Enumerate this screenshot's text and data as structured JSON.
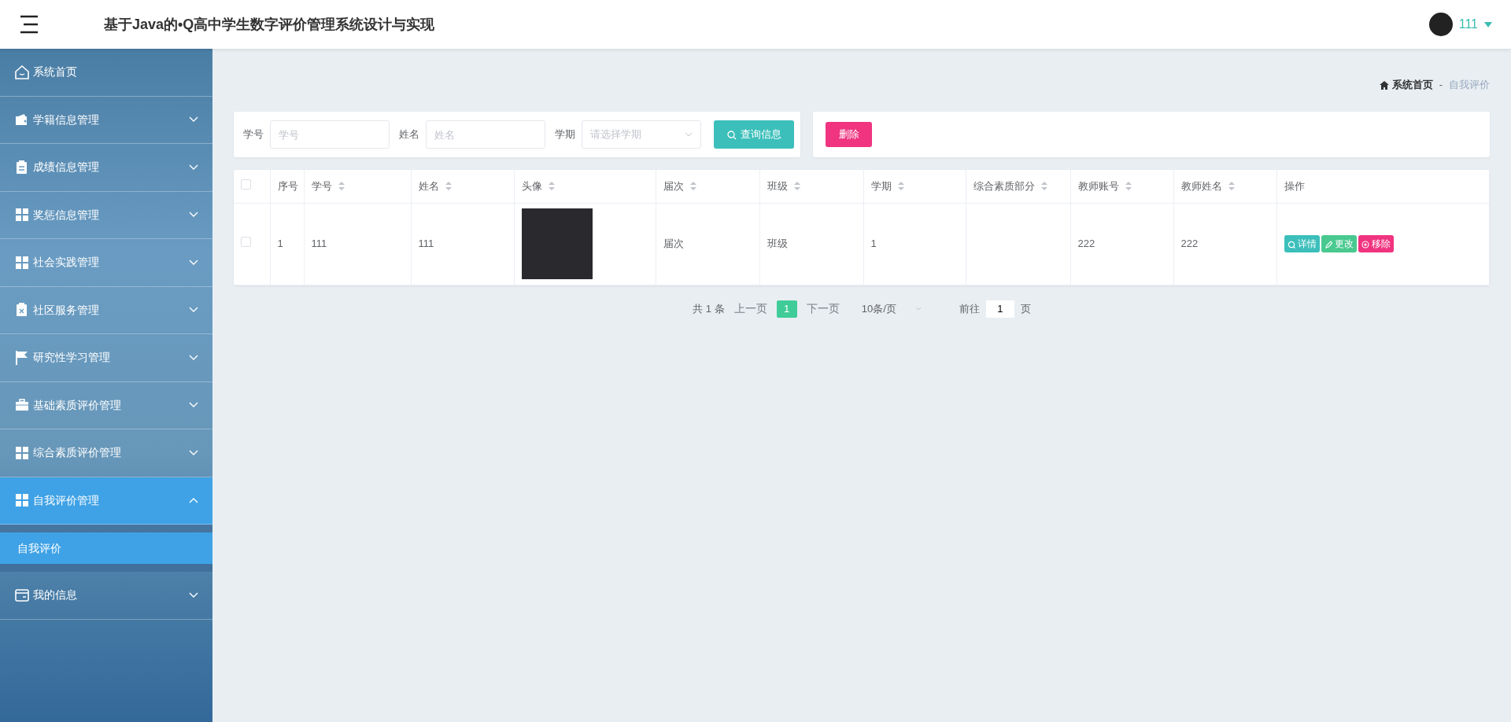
{
  "header": {
    "title": "基于Java的•Q高中学生数字评价管理系统设计与实现",
    "user_name": "111"
  },
  "sidebar": {
    "items": [
      {
        "label": "系统首页",
        "selected": false
      },
      {
        "label": "学籍信息管理",
        "expanded": false,
        "selected": false
      },
      {
        "label": "成绩信息管理",
        "expanded": false,
        "selected": false
      },
      {
        "label": "奖惩信息管理",
        "expanded": false,
        "selected": false
      },
      {
        "label": "社会实践管理",
        "expanded": false,
        "selected": false
      },
      {
        "label": "社区服务管理",
        "expanded": false,
        "selected": false
      },
      {
        "label": "研究性学习管理",
        "expanded": false,
        "selected": false
      },
      {
        "label": "基础素质评价管理",
        "expanded": false,
        "selected": false
      },
      {
        "label": "综合素质评价管理",
        "expanded": false,
        "selected": false
      },
      {
        "label": "自我评价管理",
        "expanded": true,
        "selected": true,
        "children": [
          {
            "label": "自我评价",
            "selected": true
          }
        ]
      },
      {
        "label": "我的信息",
        "expanded": false,
        "selected": false
      }
    ]
  },
  "breadcrumb": {
    "separator": "-",
    "items": [
      {
        "label": "系统首页"
      },
      {
        "label": "自我评价"
      }
    ]
  },
  "search": {
    "fields": [
      {
        "kind": "text",
        "label": "学号",
        "placeholder": "学号"
      },
      {
        "kind": "text",
        "label": "姓名",
        "placeholder": "姓名"
      },
      {
        "kind": "select",
        "label": "学期",
        "placeholder": "请选择学期"
      }
    ],
    "button": "查询信息"
  },
  "actions": {
    "delete_button": "删除"
  },
  "table": {
    "all_checked": false,
    "columns": [
      {
        "label": "序号",
        "sortable": false
      },
      {
        "label": "学号",
        "sortable": true
      },
      {
        "label": "姓名",
        "sortable": true
      },
      {
        "label": "头像",
        "sortable": true
      },
      {
        "label": "届次",
        "sortable": true
      },
      {
        "label": "班级",
        "sortable": true
      },
      {
        "label": "学期",
        "sortable": true
      },
      {
        "label": "综合素质部分",
        "sortable": true
      },
      {
        "label": "教师账号",
        "sortable": true
      },
      {
        "label": "教师姓名",
        "sortable": true
      },
      {
        "label": "操作",
        "sortable": false
      }
    ],
    "rows": [
      {
        "checked": false,
        "cells": [
          {
            "kind": "text",
            "text": "1"
          },
          {
            "kind": "text",
            "text": "111"
          },
          {
            "kind": "text",
            "text": "111"
          },
          {
            "kind": "photo"
          },
          {
            "kind": "text",
            "text": "届次"
          },
          {
            "kind": "text",
            "text": "班级"
          },
          {
            "kind": "text",
            "text": "1"
          },
          {
            "kind": "blank"
          },
          {
            "kind": "text",
            "text": "222"
          },
          {
            "kind": "text",
            "text": "222"
          },
          {
            "kind": "actions",
            "buttons": [
              {
                "kind": "detail",
                "label": "详情"
              },
              {
                "kind": "edit",
                "label": "更改"
              },
              {
                "kind": "remove",
                "label": "移除"
              }
            ]
          }
        ]
      }
    ]
  },
  "pagination": {
    "total": "共 1 条",
    "prev": "上一页",
    "pages": [
      {
        "label": "1",
        "selected": true
      }
    ],
    "next": "下一页",
    "page_size": "10条/页",
    "goto_label": "前往",
    "goto_value": "1",
    "page_unit": "页"
  }
}
